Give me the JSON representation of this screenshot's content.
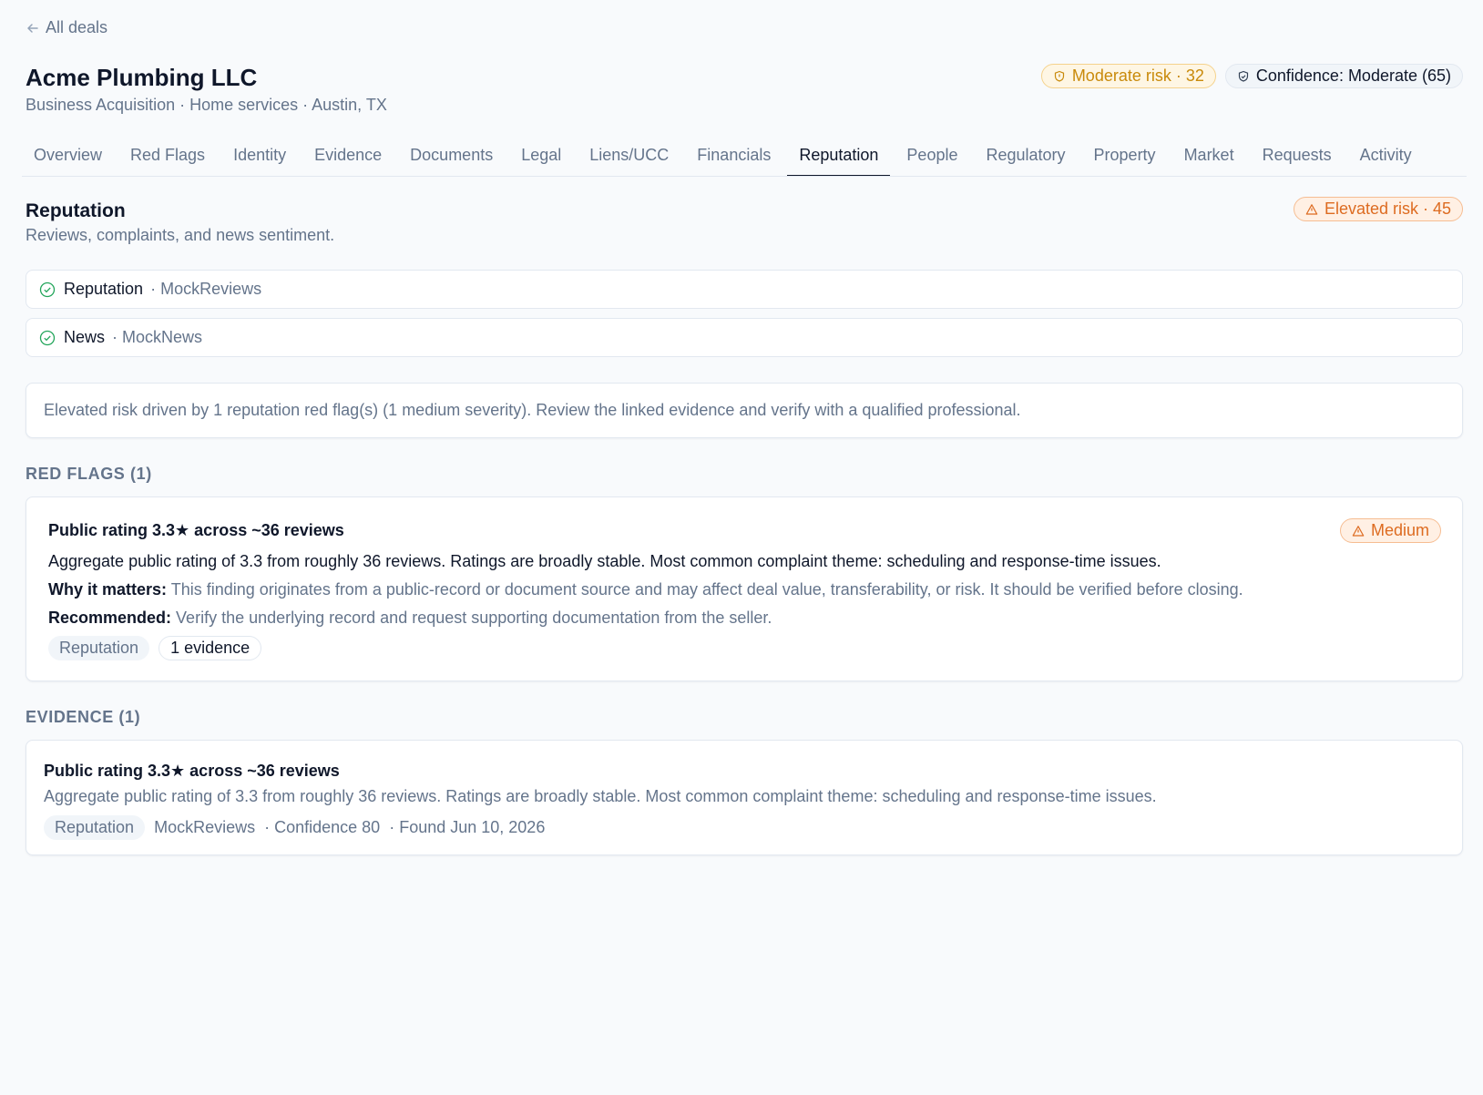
{
  "nav": {
    "back_label": "All deals"
  },
  "header": {
    "title": "Acme Plumbing LLC",
    "subtitle": "Business Acquisition · Home services · Austin, TX",
    "risk_badge": "Moderate risk · 32",
    "confidence_badge": "Confidence: Moderate (65)"
  },
  "tabs": [
    {
      "label": "Overview"
    },
    {
      "label": "Red Flags"
    },
    {
      "label": "Identity"
    },
    {
      "label": "Evidence"
    },
    {
      "label": "Documents"
    },
    {
      "label": "Legal"
    },
    {
      "label": "Liens/UCC"
    },
    {
      "label": "Financials"
    },
    {
      "label": "Reputation",
      "active": true
    },
    {
      "label": "People"
    },
    {
      "label": "Regulatory"
    },
    {
      "label": "Property"
    },
    {
      "label": "Market"
    },
    {
      "label": "Requests"
    },
    {
      "label": "Activity"
    }
  ],
  "section": {
    "title": "Reputation",
    "subtitle": "Reviews, complaints, and news sentiment.",
    "risk_badge": "Elevated risk · 45",
    "sources": [
      {
        "name": "Reputation",
        "provider": "· MockReviews"
      },
      {
        "name": "News",
        "provider": "· MockNews"
      }
    ],
    "summary": "Elevated risk driven by 1 reputation red flag(s) (1 medium severity). Review the linked evidence and verify with a qualified professional."
  },
  "red_flags": {
    "heading": "RED FLAGS (1)",
    "items": [
      {
        "title": "Public rating 3.3★ across ~36 reviews",
        "severity": "Medium",
        "description": "Aggregate public rating of 3.3 from roughly 36 reviews. Ratings are broadly stable. Most common complaint theme: scheduling and response-time issues.",
        "why_label": "Why it matters:",
        "why_text": "This finding originates from a public-record or document source and may affect deal value, transferability, or risk. It should be verified before closing.",
        "rec_label": "Recommended:",
        "rec_text": "Verify the underlying record and request supporting documentation from the seller.",
        "category": "Reputation",
        "evidence_link": "1 evidence"
      }
    ]
  },
  "evidence": {
    "heading": "EVIDENCE (1)",
    "items": [
      {
        "title": "Public rating 3.3★ across ~36 reviews",
        "text": "Aggregate public rating of 3.3 from roughly 36 reviews. Ratings are broadly stable. Most common complaint theme: scheduling and response-time issues.",
        "category": "Reputation",
        "source": "MockReviews",
        "confidence": "· Confidence 80",
        "found": "· Found Jun 10, 2026"
      }
    ]
  },
  "colors": {
    "accent_text": "#0f172a",
    "muted_text": "#64748b",
    "moderate": "#c98a0b",
    "elevated": "#dd6b20",
    "success": "#16a34a",
    "border": "#e2e8f0"
  },
  "icons": {
    "back": "arrow-left-icon",
    "moderate": "shield-icon",
    "confidence": "shield-check-icon",
    "elevated": "warning-triangle-icon",
    "source_ok": "check-circle-icon"
  }
}
